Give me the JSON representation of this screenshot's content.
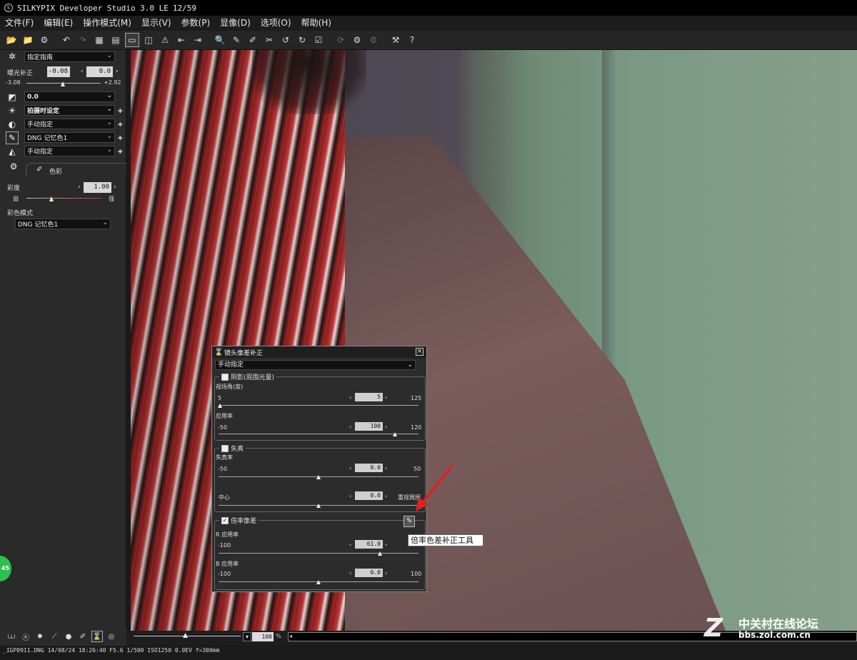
{
  "window": {
    "title": "SILKYPIX Developer Studio 3.0 LE",
    "counter": "12/59"
  },
  "menu": [
    "文件(F)",
    "编辑(E)",
    "操作模式(M)",
    "显示(V)",
    "参数(P)",
    "显像(D)",
    "选项(O)",
    "帮助(H)"
  ],
  "left_panel": {
    "preset": "指定指南",
    "exposure_label": "曝光补正",
    "exposure_value": "-0.08",
    "exposure_value2": "0.0",
    "exposure_min": "-3.08",
    "exposure_max": "+2.92",
    "contrast_select": "0.0",
    "wb_select": "拍摄时设定",
    "tone_select": "手动指定",
    "color_select": "DNG 记忆色1",
    "sharp_select": "手动指定",
    "tab_label": "色彩",
    "saturation_label": "彩度",
    "saturation_value": "1.00",
    "weak_label": "弱",
    "strong_label": "强",
    "color_mode_label": "彩色模式",
    "color_mode_select": "DNG 记忆色1"
  },
  "dialog": {
    "title": "镜头像差补正",
    "preset": "手动指定",
    "vignette": {
      "label": "阴影(周围光量)",
      "angle_label": "视场角(度)",
      "angle_min": "5",
      "angle_value": "5",
      "angle_max": "125",
      "apply_label": "应用率",
      "apply_min": "-50",
      "apply_value": "100",
      "apply_max": "120"
    },
    "distortion": {
      "label": "失真",
      "rate_label": "失真率",
      "rate_min": "-50",
      "rate_value": "0.0",
      "rate_max": "50",
      "center_label": "中心",
      "center_value": "0.0",
      "center_right": "重视周围"
    },
    "chromatic": {
      "label": "倍率像差",
      "r_label": "R 应用率",
      "r_min": "-100",
      "r_value": "61.0",
      "b_label": "B 应用率",
      "b_min": "-100",
      "b_value": "0.0",
      "b_max": "100"
    }
  },
  "tooltip": "倍率色差补正工具",
  "zoom": {
    "value": "100",
    "unit": "%"
  },
  "status": "_IGP0911.DNG 14/08/24 18:26:40 F5.6 1/500 ISO1250 0.0EV f=300mm",
  "badge": "45",
  "watermark": {
    "name": "中关村在线论坛",
    "url": "bbs.zol.com.cn"
  },
  "colors": {
    "accent_red": "#e02020",
    "badge_green": "#2fbf4f"
  }
}
